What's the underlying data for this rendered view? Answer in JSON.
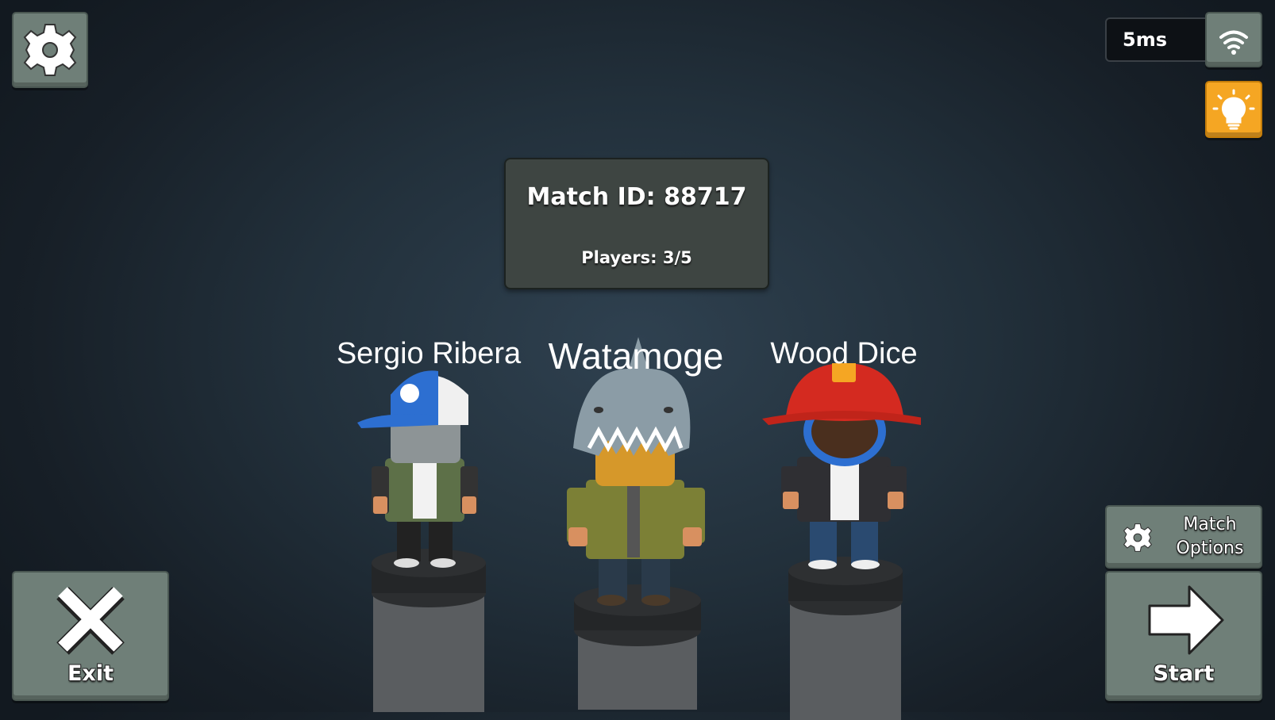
{
  "top_left": {
    "settings_icon": "gear-icon"
  },
  "network": {
    "ping": "5ms",
    "icon": "wifi-icon"
  },
  "hint": {
    "icon": "lightbulb-icon",
    "color": "#f5a623"
  },
  "match": {
    "id_label": "Match ID: 88717",
    "players_label": "Players: 3/5"
  },
  "players": [
    {
      "name": "Sergio Ribera"
    },
    {
      "name": "Watamoge"
    },
    {
      "name": "Wood Dice"
    }
  ],
  "buttons": {
    "exit": {
      "label": "Exit",
      "icon": "close-x-icon"
    },
    "match_options": {
      "label_line1": "Match",
      "label_line2": "Options",
      "icon": "gear-icon"
    },
    "start": {
      "label": "Start",
      "icon": "arrow-right-icon"
    }
  }
}
